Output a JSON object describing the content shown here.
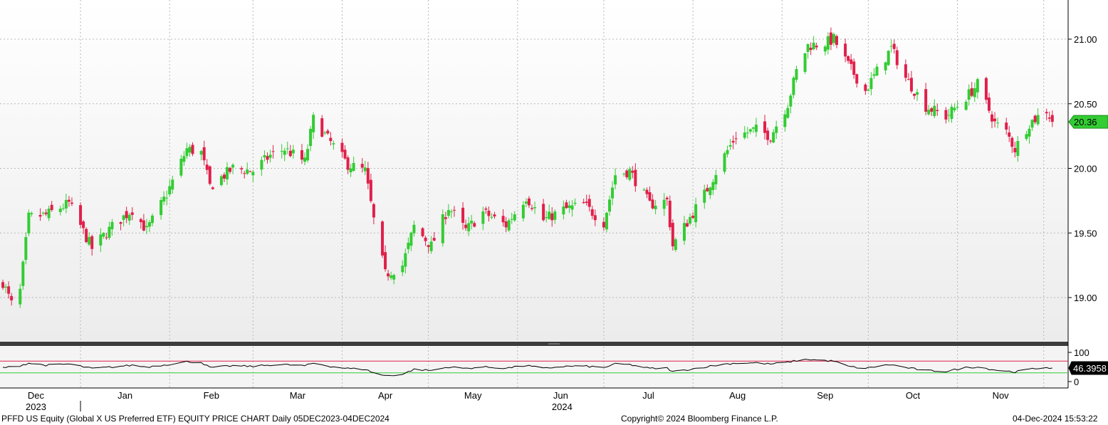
{
  "chart_data": [
    {
      "type": "candlestick",
      "y_range": [
        18.65,
        21.3
      ],
      "y_ticks": [
        "21.00",
        "20.50",
        "20.00",
        "19.50",
        "19.00"
      ],
      "last_price_label": "20.36",
      "month_labels": [
        "Dec",
        "Jan",
        "Feb",
        "Mar",
        "Apr",
        "May",
        "Jun",
        "Jul",
        "Aug",
        "Sep",
        "Oct",
        "Nov"
      ],
      "year_labels": [
        "2023",
        "2024"
      ],
      "grid": true,
      "colors": {
        "up": "#33cc33",
        "down": "#e0204a",
        "last_label_bg": "#33cc33"
      },
      "anchors": [
        [
          "2023-12-05",
          19.12
        ],
        [
          "2023-12-08",
          18.95
        ],
        [
          "2023-12-11",
          19.05
        ],
        [
          "2023-12-14",
          19.62
        ],
        [
          "2023-12-20",
          19.64
        ],
        [
          "2023-12-28",
          19.73
        ],
        [
          "2024-01-05",
          19.38
        ],
        [
          "2024-01-12",
          19.55
        ],
        [
          "2024-01-19",
          19.68
        ],
        [
          "2024-01-24",
          19.52
        ],
        [
          "2024-01-31",
          19.8
        ],
        [
          "2024-02-07",
          20.15
        ],
        [
          "2024-02-12",
          20.12
        ],
        [
          "2024-02-15",
          19.86
        ],
        [
          "2024-02-23",
          20.0
        ],
        [
          "2024-03-01",
          19.98
        ],
        [
          "2024-03-07",
          20.1
        ],
        [
          "2024-03-12",
          20.15
        ],
        [
          "2024-03-19",
          20.05
        ],
        [
          "2024-03-22",
          20.38
        ],
        [
          "2024-03-28",
          20.2
        ],
        [
          "2024-04-03",
          20.03
        ],
        [
          "2024-04-09",
          19.98
        ],
        [
          "2024-04-12",
          19.6
        ],
        [
          "2024-04-16",
          19.18
        ],
        [
          "2024-04-22",
          19.25
        ],
        [
          "2024-04-26",
          19.55
        ],
        [
          "2024-05-02",
          19.4
        ],
        [
          "2024-05-08",
          19.7
        ],
        [
          "2024-05-14",
          19.52
        ],
        [
          "2024-05-20",
          19.66
        ],
        [
          "2024-05-28",
          19.56
        ],
        [
          "2024-06-04",
          19.78
        ],
        [
          "2024-06-10",
          19.6
        ],
        [
          "2024-06-17",
          19.68
        ],
        [
          "2024-06-24",
          19.72
        ],
        [
          "2024-07-01",
          19.58
        ],
        [
          "2024-07-05",
          19.95
        ],
        [
          "2024-07-10",
          19.98
        ],
        [
          "2024-07-17",
          19.72
        ],
        [
          "2024-07-23",
          19.75
        ],
        [
          "2024-07-25",
          19.4
        ],
        [
          "2024-07-31",
          19.62
        ],
        [
          "2024-08-05",
          19.8
        ],
        [
          "2024-08-12",
          20.1
        ],
        [
          "2024-08-16",
          20.25
        ],
        [
          "2024-08-23",
          20.3
        ],
        [
          "2024-08-28",
          20.25
        ],
        [
          "2024-09-03",
          20.5
        ],
        [
          "2024-09-06",
          20.75
        ],
        [
          "2024-09-10",
          20.95
        ],
        [
          "2024-09-16",
          20.97
        ],
        [
          "2024-09-19",
          21.0
        ],
        [
          "2024-09-24",
          20.8
        ],
        [
          "2024-09-30",
          20.6
        ],
        [
          "2024-10-04",
          20.75
        ],
        [
          "2024-10-09",
          20.93
        ],
        [
          "2024-10-14",
          20.7
        ],
        [
          "2024-10-21",
          20.48
        ],
        [
          "2024-10-28",
          20.4
        ],
        [
          "2024-11-04",
          20.55
        ],
        [
          "2024-11-08",
          20.65
        ],
        [
          "2024-11-14",
          20.35
        ],
        [
          "2024-11-18",
          20.28
        ],
        [
          "2024-11-21",
          20.15
        ],
        [
          "2024-11-26",
          20.35
        ],
        [
          "2024-12-02",
          20.45
        ],
        [
          "2024-12-04",
          20.36
        ]
      ]
    },
    {
      "type": "line",
      "indicator_value_label": "46.3958",
      "y_ticks": [
        "100",
        "0"
      ],
      "overbought_level": 70,
      "oversold_level": 30,
      "colors": {
        "line": "#000000",
        "overbought": "#e0204a",
        "oversold": "#33cc33"
      },
      "anchors": [
        [
          "2023-12-05",
          48
        ],
        [
          "2023-12-08",
          50
        ],
        [
          "2023-12-11",
          55
        ],
        [
          "2023-12-14",
          63
        ],
        [
          "2023-12-20",
          56
        ],
        [
          "2023-12-28",
          60
        ],
        [
          "2024-01-05",
          45
        ],
        [
          "2024-01-12",
          50
        ],
        [
          "2024-01-19",
          56
        ],
        [
          "2024-01-24",
          50
        ],
        [
          "2024-01-31",
          58
        ],
        [
          "2024-02-07",
          68
        ],
        [
          "2024-02-12",
          66
        ],
        [
          "2024-02-15",
          48
        ],
        [
          "2024-02-23",
          54
        ],
        [
          "2024-03-01",
          52
        ],
        [
          "2024-03-07",
          57
        ],
        [
          "2024-03-12",
          58
        ],
        [
          "2024-03-19",
          54
        ],
        [
          "2024-03-22",
          63
        ],
        [
          "2024-03-28",
          52
        ],
        [
          "2024-04-03",
          45
        ],
        [
          "2024-04-09",
          42
        ],
        [
          "2024-04-12",
          30
        ],
        [
          "2024-04-16",
          20
        ],
        [
          "2024-04-22",
          25
        ],
        [
          "2024-04-26",
          42
        ],
        [
          "2024-05-02",
          38
        ],
        [
          "2024-05-08",
          50
        ],
        [
          "2024-05-14",
          45
        ],
        [
          "2024-05-20",
          50
        ],
        [
          "2024-05-28",
          46
        ],
        [
          "2024-06-04",
          55
        ],
        [
          "2024-06-10",
          45
        ],
        [
          "2024-06-17",
          52
        ],
        [
          "2024-06-24",
          53
        ],
        [
          "2024-07-01",
          48
        ],
        [
          "2024-07-05",
          60
        ],
        [
          "2024-07-10",
          58
        ],
        [
          "2024-07-17",
          45
        ],
        [
          "2024-07-23",
          46
        ],
        [
          "2024-07-25",
          34
        ],
        [
          "2024-07-31",
          42
        ],
        [
          "2024-08-05",
          50
        ],
        [
          "2024-08-12",
          60
        ],
        [
          "2024-08-16",
          63
        ],
        [
          "2024-08-23",
          64
        ],
        [
          "2024-08-28",
          60
        ],
        [
          "2024-09-03",
          66
        ],
        [
          "2024-09-06",
          72
        ],
        [
          "2024-09-10",
          76
        ],
        [
          "2024-09-16",
          72
        ],
        [
          "2024-09-19",
          70
        ],
        [
          "2024-09-24",
          52
        ],
        [
          "2024-09-30",
          45
        ],
        [
          "2024-10-04",
          52
        ],
        [
          "2024-10-09",
          58
        ],
        [
          "2024-10-14",
          48
        ],
        [
          "2024-10-21",
          38
        ],
        [
          "2024-10-28",
          35
        ],
        [
          "2024-11-04",
          48
        ],
        [
          "2024-11-08",
          50
        ],
        [
          "2024-11-14",
          40
        ],
        [
          "2024-11-18",
          36
        ],
        [
          "2024-11-21",
          33
        ],
        [
          "2024-11-26",
          42
        ],
        [
          "2024-12-02",
          49
        ],
        [
          "2024-12-04",
          46.4
        ]
      ]
    }
  ],
  "footer": {
    "title": "PFFD US Equity (Global X US Preferred ETF) EQUITY PRICE CHART  Daily 05DEC2023-04DEC2024",
    "copyright": "Copyright© 2024 Bloomberg Finance L.P.",
    "timestamp": "04-Dec-2024 15:53:22"
  }
}
